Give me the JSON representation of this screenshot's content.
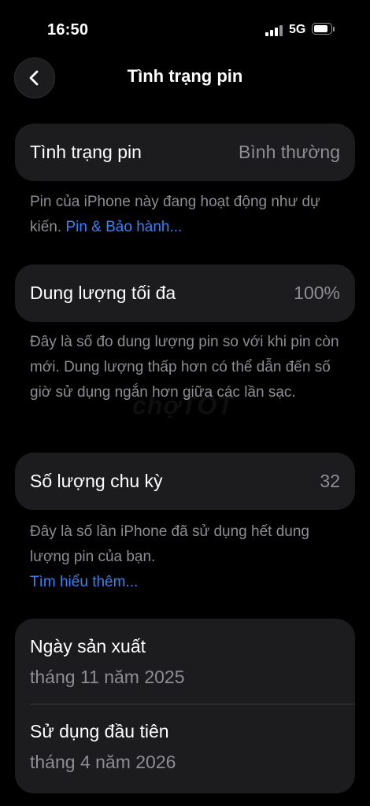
{
  "status_bar": {
    "time": "16:50",
    "network": "5G"
  },
  "nav": {
    "title": "Tình trạng pin"
  },
  "health": {
    "label": "Tình trạng pin",
    "value": "Bình thường"
  },
  "health_note": {
    "text": "Pin của iPhone này đang hoạt động như dự kiến. ",
    "link": "Pin & Bảo hành..."
  },
  "capacity": {
    "label": "Dung lượng tối đa",
    "value": "100%"
  },
  "capacity_note": {
    "text": "Đây là số đo dung lượng pin so với khi pin còn mới. Dung lượng thấp hơn có thể dẫn đến số giờ sử dụng ngắn hơn giữa các lần sạc."
  },
  "cycles": {
    "label": "Số lượng chu kỳ",
    "value": "32"
  },
  "cycles_note": {
    "text": "Đây là số lần iPhone đã sử dụng hết dung lượng pin của bạn.",
    "link": "Tìm hiểu thêm..."
  },
  "dates": {
    "manufacture_label": "Ngày sản xuất",
    "manufacture_value": "tháng 11 năm 2025",
    "first_use_label": "Sử dụng đầu tiên",
    "first_use_value": "tháng 4 năm 2026"
  },
  "watermark": "chợTỐT"
}
